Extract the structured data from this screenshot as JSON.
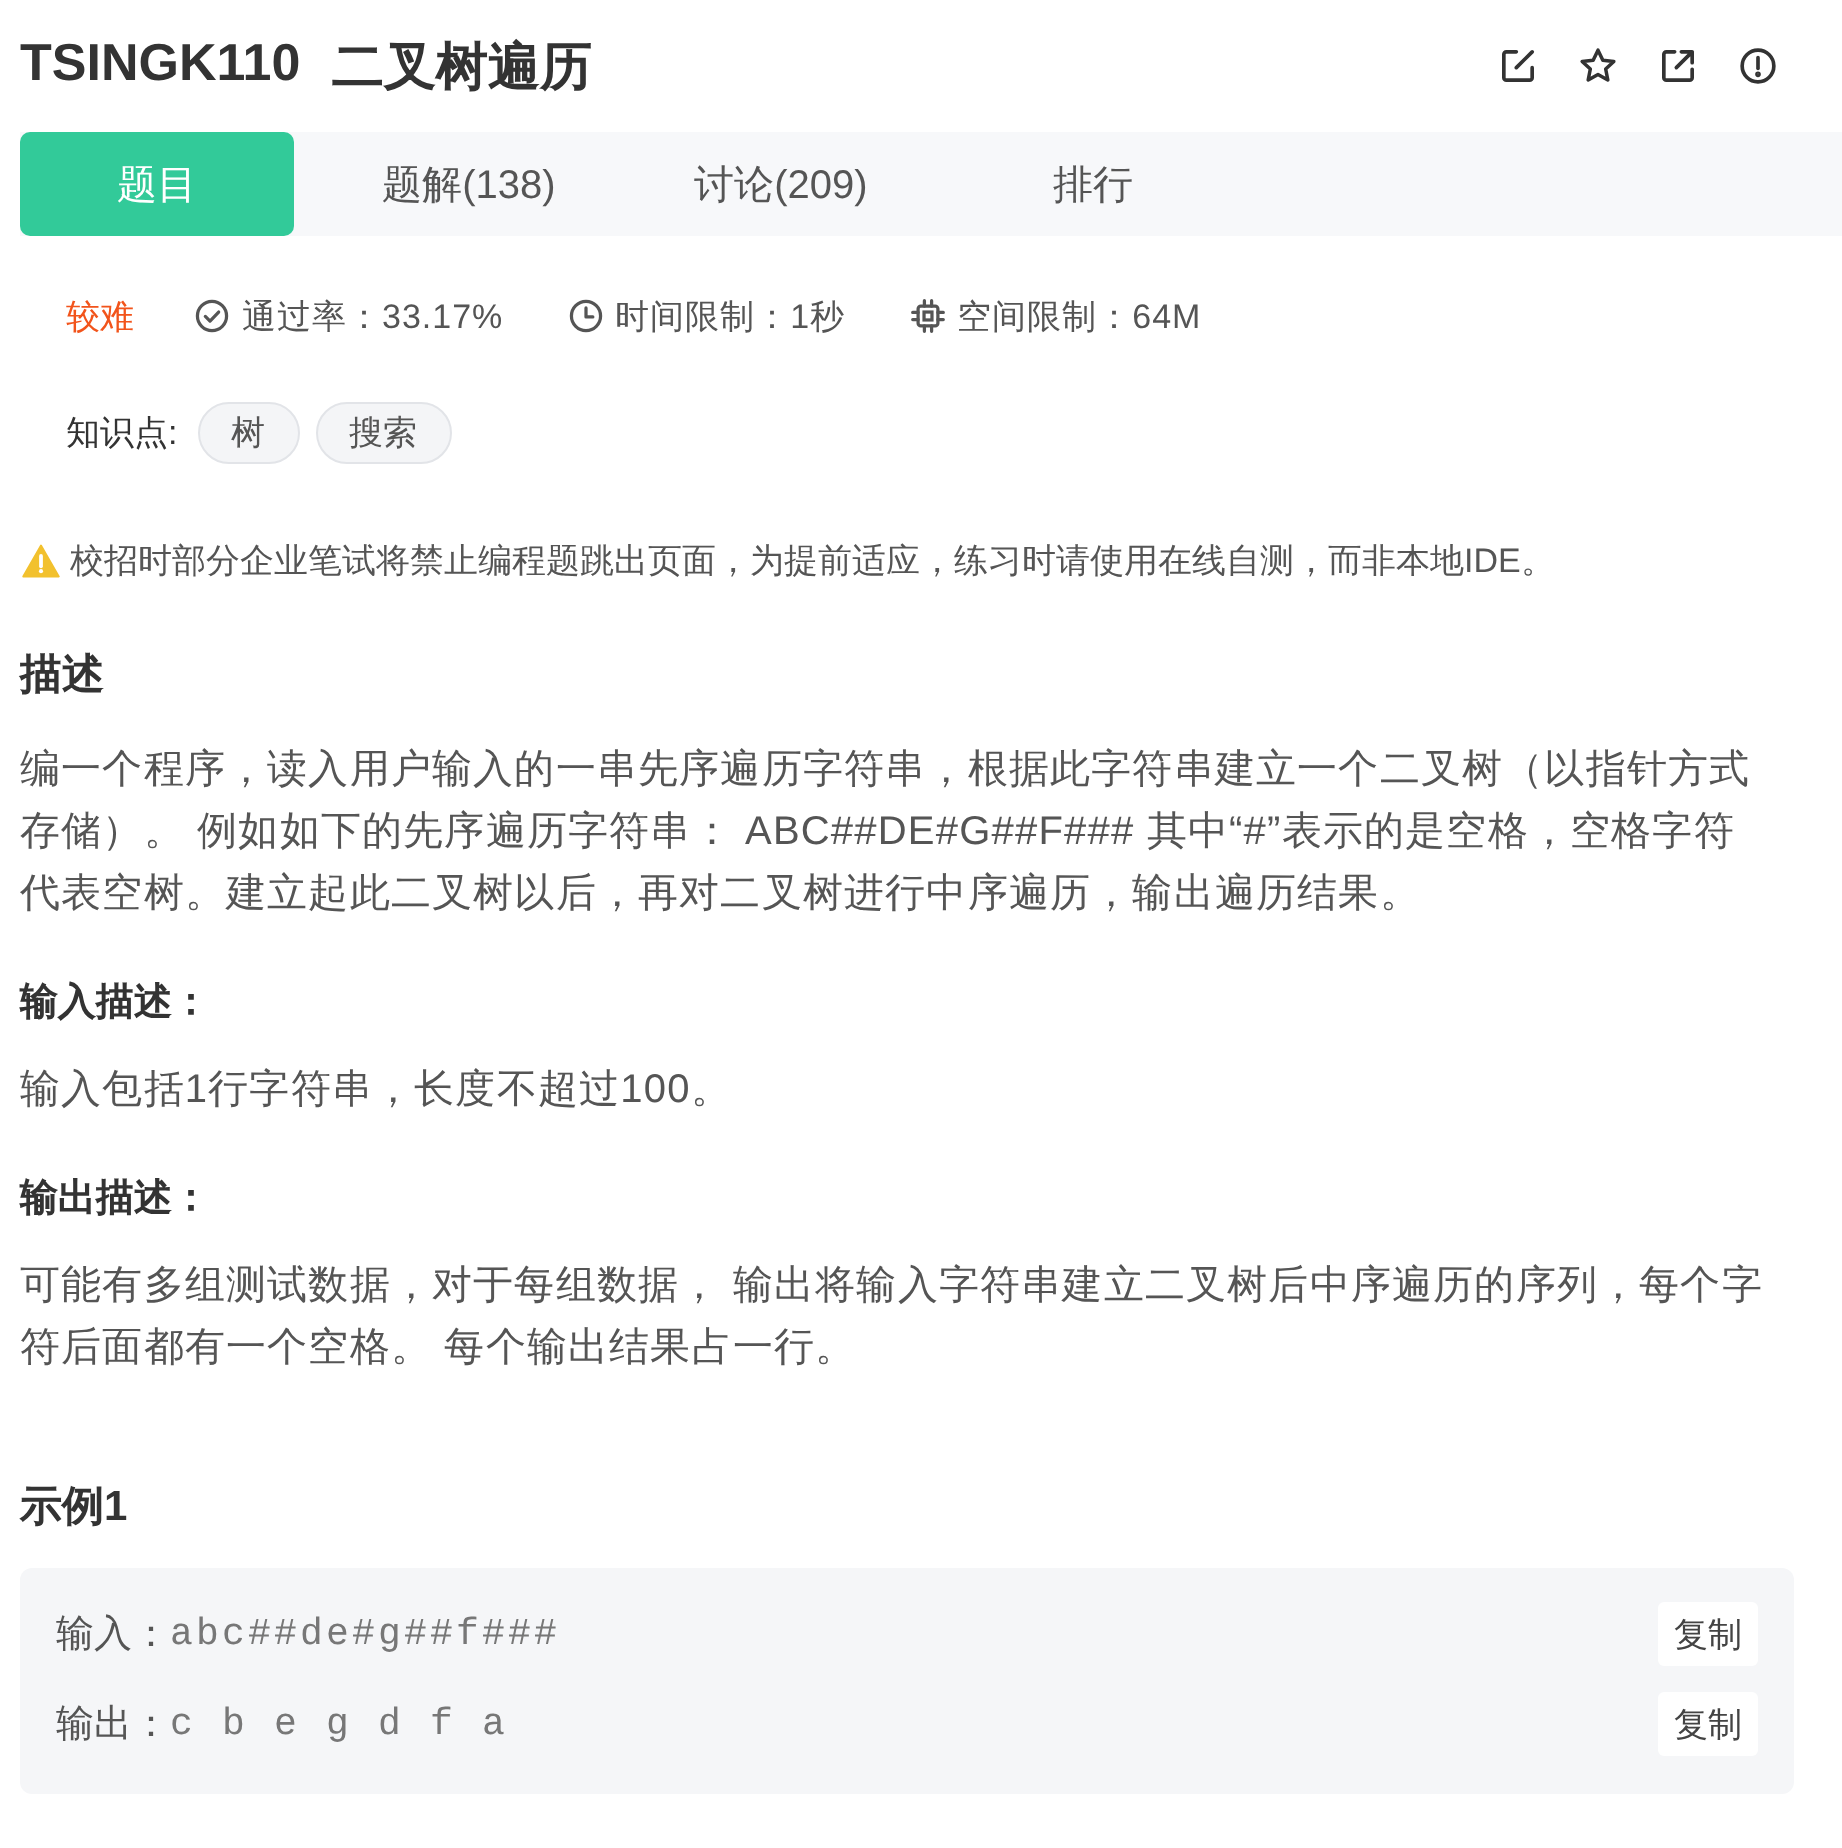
{
  "header": {
    "problem_id": "TSINGK110",
    "title": "二叉树遍历"
  },
  "tabs": [
    {
      "label": "题目",
      "selected": true
    },
    {
      "label": "题解(138)",
      "selected": false
    },
    {
      "label": "讨论(209)",
      "selected": false
    },
    {
      "label": "排行",
      "selected": false
    }
  ],
  "meta": {
    "difficulty": "较难",
    "stats": [
      {
        "kind": "pass_rate",
        "text": "通过率：33.17%"
      },
      {
        "kind": "time",
        "text": "时间限制：1秒"
      },
      {
        "kind": "memory",
        "text": "空间限制：64M"
      }
    ]
  },
  "knowledge": {
    "label": "知识点:",
    "tags": [
      "树",
      "搜索"
    ]
  },
  "notice": "校招时部分企业笔试将禁止编程题跳出页面，为提前适应，练习时请使用在线自测，而非本地IDE。",
  "description": {
    "heading": "描述",
    "text": "编一个程序，读入用户输入的一串先序遍历字符串，根据此字符串建立一个二叉树（以指针方式存储）。 例如如下的先序遍历字符串： ABC##DE#G##F### 其中“#”表示的是空格，空格字符代表空树。建立起此二叉树以后，再对二叉树进行中序遍历，输出遍历结果。"
  },
  "input_description": {
    "heading": "输入描述：",
    "text": "输入包括1行字符串，长度不超过100。"
  },
  "output_description": {
    "heading": "输出描述：",
    "text": "可能有多组测试数据，对于每组数据， 输出将输入字符串建立二叉树后中序遍历的序列，每个字符后面都有一个空格。 每个输出结果占一行。"
  },
  "example": {
    "heading": "示例1",
    "rows": [
      {
        "label": "输入：",
        "value": "abc##de#g##f###",
        "button": "复制"
      },
      {
        "label": "输出：",
        "value": "c b e g d f a",
        "button": "复制"
      }
    ]
  }
}
